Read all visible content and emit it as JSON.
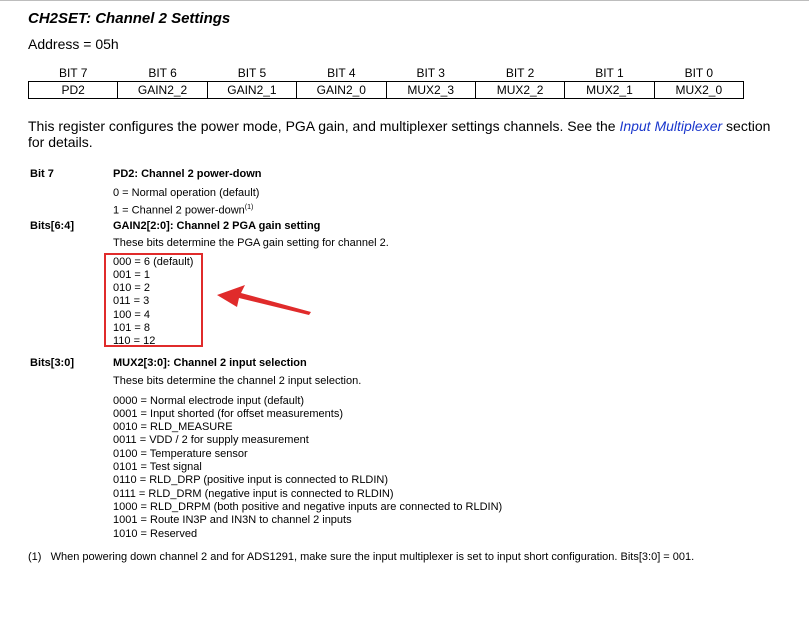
{
  "title": "CH2SET: Channel 2 Settings",
  "address": "Address = 05h",
  "register": {
    "bits": [
      "BIT 7",
      "BIT 6",
      "BIT 5",
      "BIT 4",
      "BIT 3",
      "BIT 2",
      "BIT 1",
      "BIT 0"
    ],
    "fields": [
      "PD2",
      "GAIN2_2",
      "GAIN2_1",
      "GAIN2_0",
      "MUX2_3",
      "MUX2_2",
      "MUX2_1",
      "MUX2_0"
    ]
  },
  "intro": {
    "text_before": "This register configures the power mode, PGA gain, and multiplexer settings channels. See the ",
    "link": "Input Multiplexer",
    "text_after": "section for details."
  },
  "sections": [
    {
      "label": "Bit 7",
      "heading": "PD2: Channel 2 power-down",
      "description": "",
      "options": [
        "0 = Normal operation (default)",
        "1 = Channel 2 power-down"
      ],
      "option_note": "(1)"
    },
    {
      "label": "Bits[6:4]",
      "heading": "GAIN2[2:0]: Channel 2 PGA gain setting",
      "description": "These bits determine the PGA gain setting for channel 2.",
      "options": [
        "000 = 6 (default)",
        "001 = 1",
        "010 = 2",
        "011 = 3",
        "100 = 4",
        "101 = 8",
        "110 = 12"
      ]
    },
    {
      "label": "Bits[3:0]",
      "heading": "MUX2[3:0]: Channel 2 input selection",
      "description": "These bits determine the channel 2 input selection.",
      "options": [
        "0000 = Normal electrode input (default)",
        "0001 = Input shorted (for offset measurements)",
        "0010 = RLD_MEASURE",
        "0011 = VDD / 2 for supply measurement",
        "0100 = Temperature sensor",
        "0101 = Test signal",
        "0110 = RLD_DRP (positive input is connected to RLDIN)",
        "0111 = RLD_DRM (negative input is connected to RLDIN)",
        "1000 = RLD_DRPM (both positive and negative inputs are connected to RLDIN)",
        "1001 = Route IN3P and IN3N to channel 2 inputs",
        "1010 = Reserved"
      ]
    }
  ],
  "footnote": {
    "marker": "(1)",
    "text": "When powering down channel 2 and for ADS1291, make sure the input multiplexer is set to input short configuration. Bits[3:0] = 001."
  },
  "annotation_color": "#e02b2b"
}
